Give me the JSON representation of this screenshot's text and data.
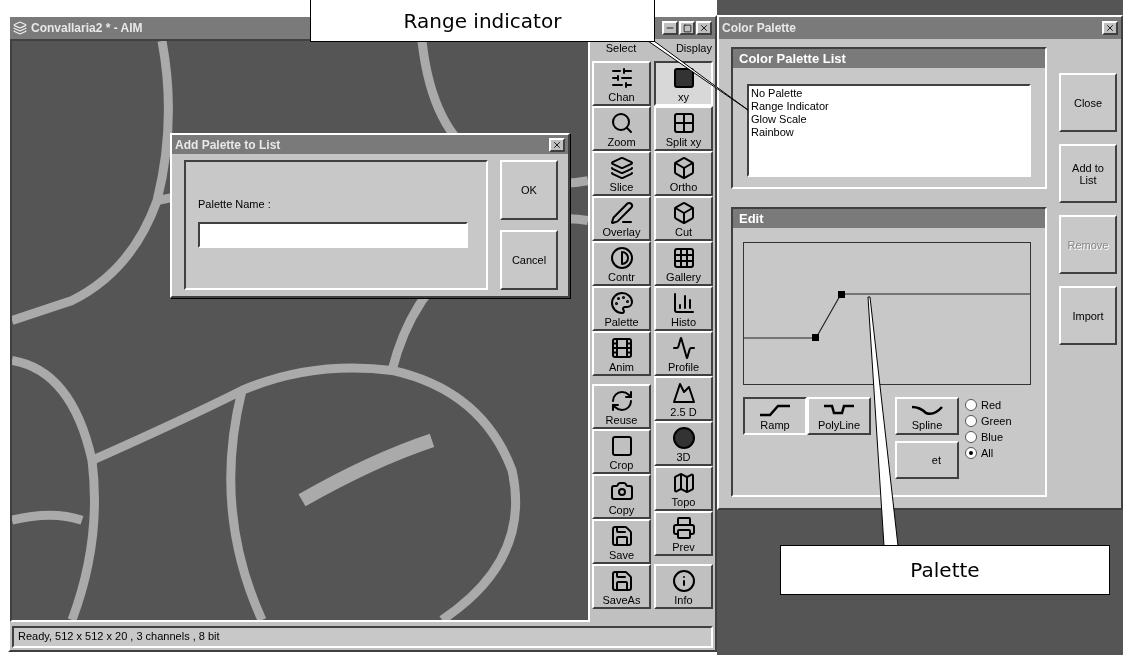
{
  "main_window": {
    "title": "Convallaria2 * - AIM",
    "status_bar": "Ready, 512 x 512 x 20 , 3 channels , 8 bit"
  },
  "toolbar": {
    "select": {
      "heading": "Select",
      "tools": [
        {
          "label": "Chan"
        },
        {
          "label": "Zoom"
        },
        {
          "label": "Slice"
        },
        {
          "label": "Overlay"
        },
        {
          "label": "Contr"
        },
        {
          "label": "Palette"
        },
        {
          "label": "Anim"
        }
      ],
      "tools_lower": [
        {
          "label": "Reuse"
        },
        {
          "label": "Crop"
        },
        {
          "label": "Copy"
        },
        {
          "label": "Save"
        },
        {
          "label": "SaveAs"
        }
      ]
    },
    "display": {
      "heading": "Display",
      "tools": [
        {
          "label": "xy",
          "selected": true
        },
        {
          "label": "Split xy",
          "selected": false
        },
        {
          "label": "Ortho",
          "selected": false
        },
        {
          "label": "Cut",
          "selected": false
        },
        {
          "label": "Gallery",
          "selected": false
        },
        {
          "label": "Histo",
          "selected": false
        },
        {
          "label": "Profile",
          "selected": false
        },
        {
          "label": "2.5 D",
          "selected": false
        },
        {
          "label": "3D",
          "selected": false
        },
        {
          "label": "Topo",
          "selected": false
        },
        {
          "label": "Prev",
          "selected": false
        }
      ],
      "tools_lower": [
        {
          "label": "Info",
          "selected": false
        }
      ]
    }
  },
  "add_dialog": {
    "title": "Add Palette to List",
    "field_label": "Palette Name :",
    "buttons": [
      "OK",
      "Cancel"
    ]
  },
  "color_palette": {
    "title": "Color Palette",
    "list_heading": "Color Palette List",
    "items": [
      {
        "label": "No Palette",
        "selected": false
      },
      {
        "label": "Range Indicator",
        "selected": false
      },
      {
        "label": "Glow Scale",
        "selected": false
      },
      {
        "label": "Rainbow",
        "selected": false
      }
    ],
    "edit_heading": "Edit",
    "modes": [
      {
        "label": "Ramp",
        "selected": true
      },
      {
        "label": "PolyLine",
        "selected": false
      },
      {
        "label": "Spline",
        "selected": false
      }
    ],
    "reset_button": "et",
    "channels": [
      {
        "label": "Red",
        "selected": false
      },
      {
        "label": "Green",
        "selected": false
      },
      {
        "label": "Blue",
        "selected": false
      },
      {
        "label": "All",
        "selected": true
      }
    ],
    "side_buttons": [
      {
        "label": "Close",
        "disabled": false
      },
      {
        "label": "Add to List",
        "disabled": false
      },
      {
        "label": "Remove",
        "disabled": true
      },
      {
        "label": "Import",
        "disabled": false
      }
    ]
  },
  "callouts": [
    {
      "text": "Range indicator"
    },
    {
      "text": "Palette"
    }
  ]
}
